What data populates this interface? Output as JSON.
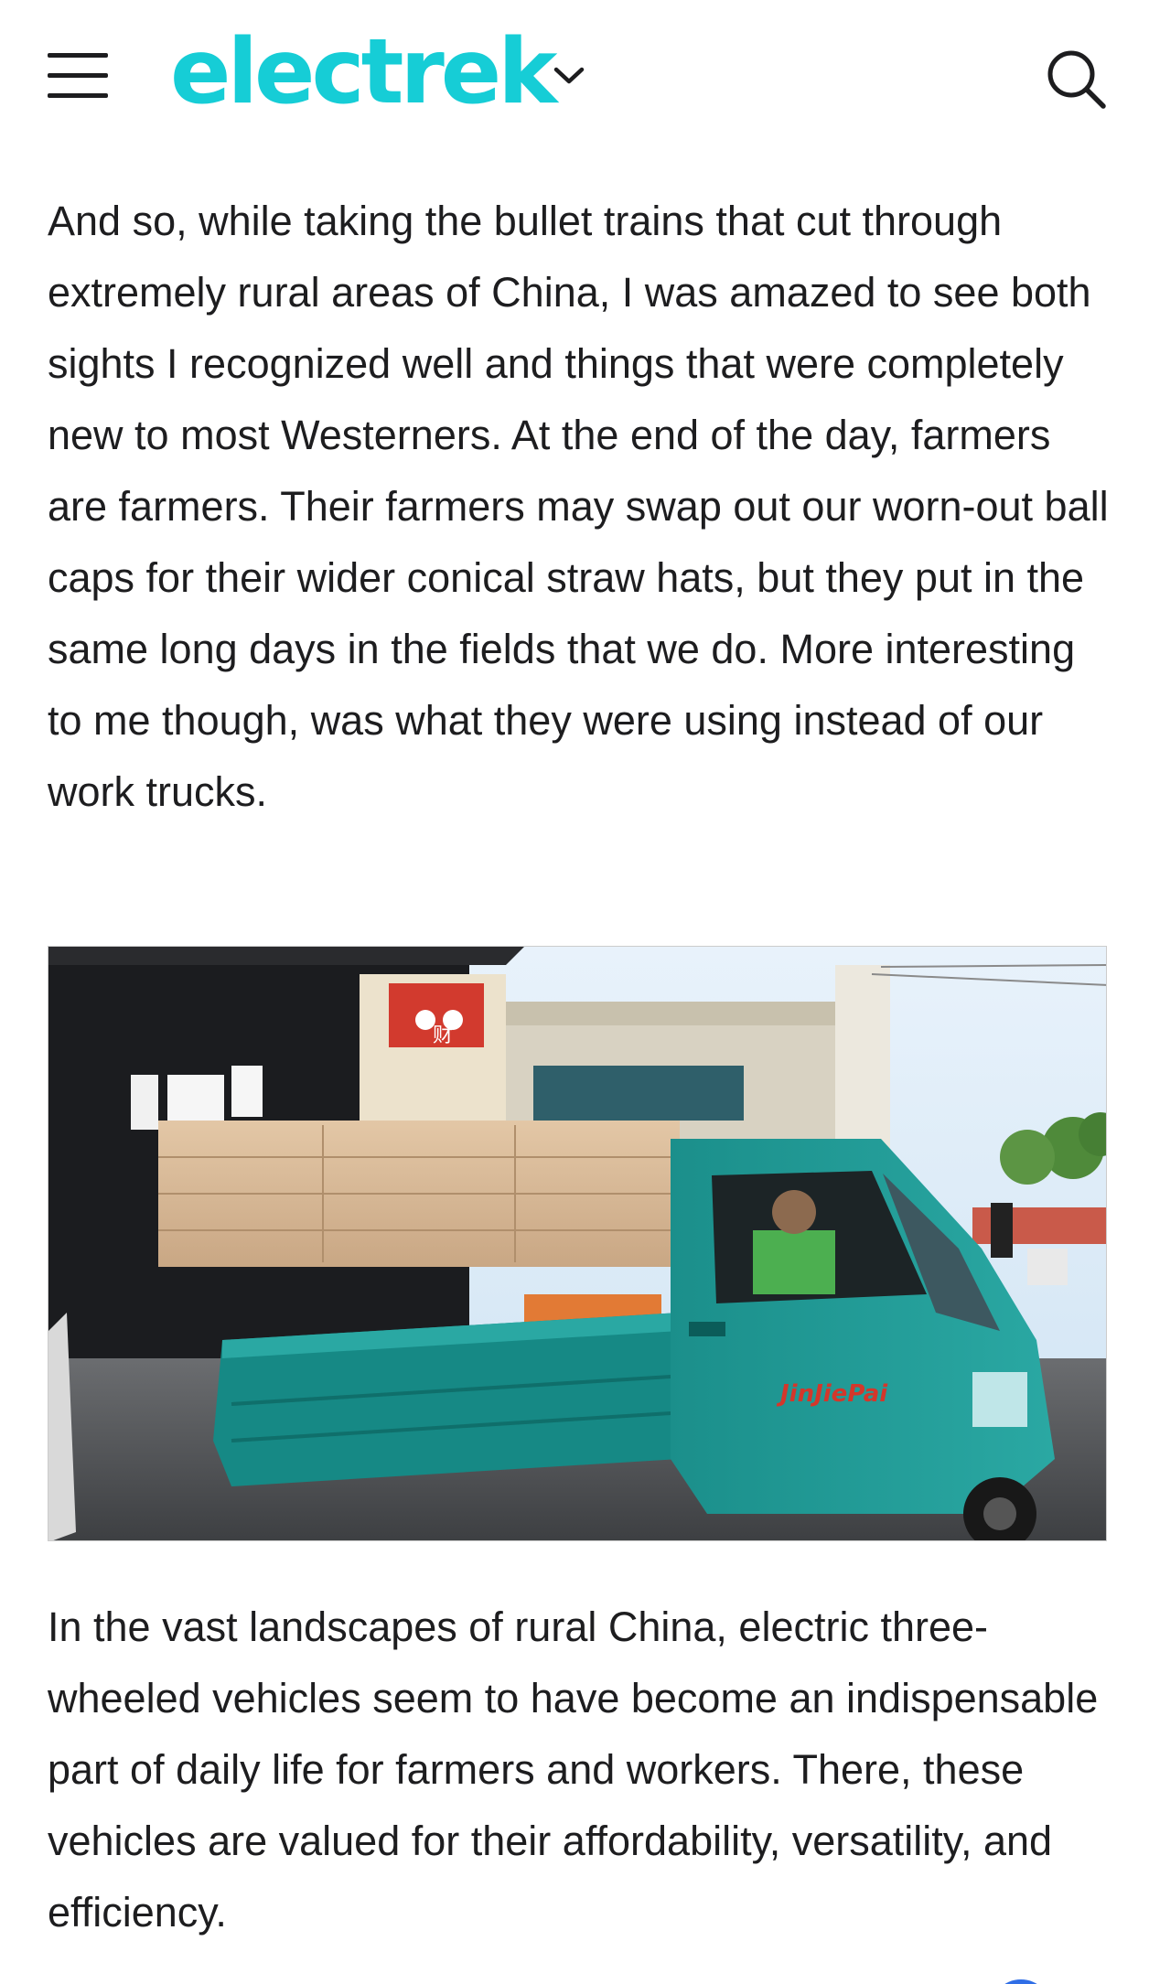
{
  "header": {
    "logo_text": "electrek",
    "logo_color": "#16cdd6",
    "menu_icon": "hamburger-menu-icon",
    "dropdown_icon": "chevron-down-icon",
    "search_icon": "search-icon"
  },
  "article": {
    "paragraph_1": "And so, while taking the bullet trains that cut through extremely rural areas of China, I was amazed to see both sights I recognized well and things that were completely new to most Westerners. At the end of the day, farmers are farmers. Their farmers may swap out our worn-out ball caps for their wider conical straw hats, but they put in the same long days in the fields that we do. More interesting to me though, was what they were using instead of our work trucks.",
    "image": {
      "vehicle_branding": "JinJiePai",
      "sign_glyph": "财"
    },
    "paragraph_2": "In the vast landscapes of rural China, electric three-wheeled vehicles seem to have become an indispensable part of daily life for farmers and workers. There, these vehicles are valued for their affordability, versatility, and efficiency."
  },
  "colors": {
    "vehicle": "#1f9a96",
    "text": "#1d1d1f"
  }
}
